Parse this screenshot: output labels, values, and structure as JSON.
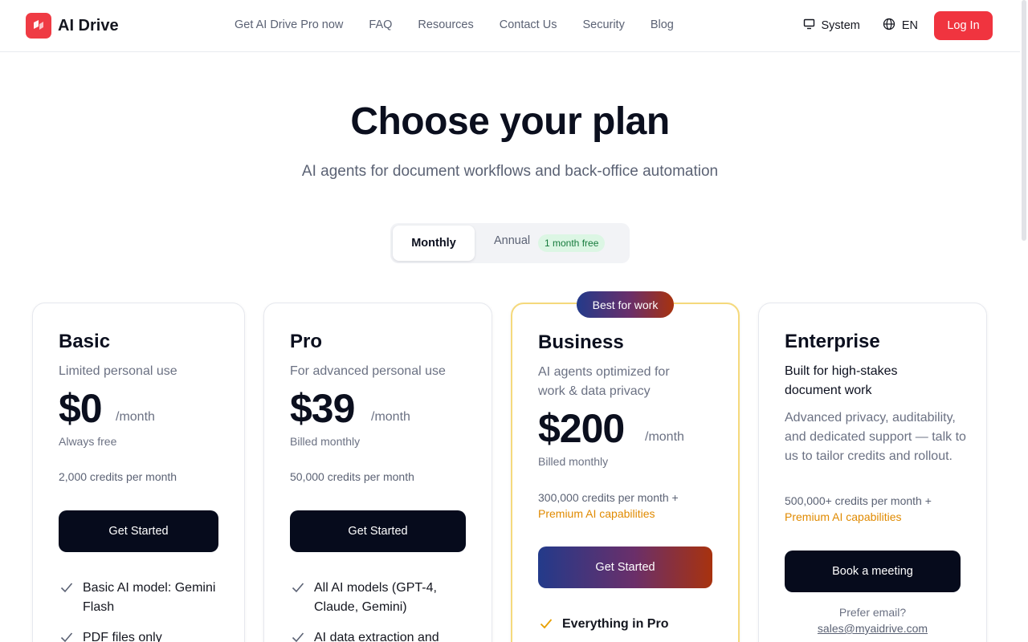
{
  "brand": {
    "name": "AI Drive"
  },
  "nav": {
    "items": [
      "Get AI Drive Pro now",
      "FAQ",
      "Resources",
      "Contact Us",
      "Security",
      "Blog"
    ]
  },
  "header_right": {
    "theme_label": "System",
    "language_label": "EN",
    "login_label": "Log In"
  },
  "hero": {
    "title": "Choose your plan",
    "subtitle": "AI agents for document workflows and back-office automation"
  },
  "billing_toggle": {
    "monthly": "Monthly",
    "annual": "Annual",
    "annual_badge": "1 month free",
    "selected": "Monthly"
  },
  "plans": {
    "basic": {
      "name": "Basic",
      "description": "Limited personal use",
      "price": "$0",
      "period": "/month",
      "billing_note": "Always free",
      "credits": "2,000 credits per month",
      "cta": "Get Started",
      "features": [
        "Basic AI model: Gemini Flash",
        "PDF files only"
      ]
    },
    "pro": {
      "name": "Pro",
      "description": "For advanced personal use",
      "price": "$39",
      "period": "/month",
      "billing_note": "Billed monthly",
      "credits": "50,000 credits per month",
      "cta": "Get Started",
      "features": [
        "All AI models (GPT-4, Claude, Gemini)",
        "AI data extraction and"
      ]
    },
    "business": {
      "badge": "Best for work",
      "name": "Business",
      "description": "AI agents optimized for work & data privacy",
      "price": "$200",
      "period": "/month",
      "billing_note": "Billed monthly",
      "credits": "300,000 credits per month +",
      "premium": "Premium AI capabilities",
      "cta": "Get Started",
      "features": [
        "Everything in Pro"
      ]
    },
    "enterprise": {
      "name": "Enterprise",
      "tagline": "Built for high-stakes document work",
      "description": "Advanced privacy, auditability, and dedicated support — talk to us to tailor credits and rollout.",
      "credits": "500,000+ credits per month +",
      "premium": "Premium AI capabilities",
      "cta": "Book a meeting",
      "prefer_email": "Prefer email?",
      "email": "sales@myaidrive.com"
    }
  },
  "colors": {
    "brand_red": "#ef3b44",
    "login_red": "#f0343f",
    "dark_button": "#060b1c",
    "premium_orange": "#e08a00",
    "badge_green_bg": "#dcf6e4",
    "business_border": "#f5d97c"
  },
  "icons": [
    "drive-logo-icon",
    "monitor-icon",
    "globe-icon",
    "check-icon"
  ]
}
